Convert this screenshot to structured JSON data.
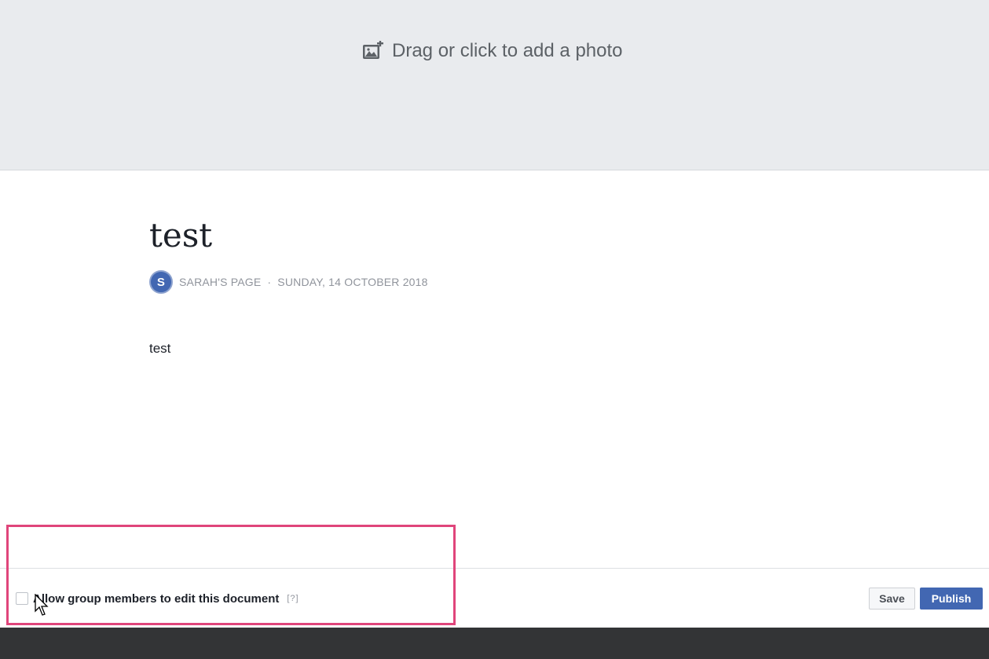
{
  "cover": {
    "cta_label": "Drag or click to add a photo",
    "icon": "add-photo-icon"
  },
  "note": {
    "title": "test",
    "author": "SARAH'S PAGE",
    "separator": "·",
    "date": "SUNDAY, 14 OCTOBER 2018",
    "avatar_letter": "S",
    "body": "test"
  },
  "permissions": {
    "checkbox_label": "Allow group members to edit this document",
    "help_label": "[?]",
    "checked": false
  },
  "actions": {
    "save_label": "Save",
    "publish_label": "Publish"
  },
  "colors": {
    "accent": "#4267b2",
    "highlight": "#e0457b",
    "cover_bg": "#e9ebee",
    "footer_bg": "#333436"
  }
}
